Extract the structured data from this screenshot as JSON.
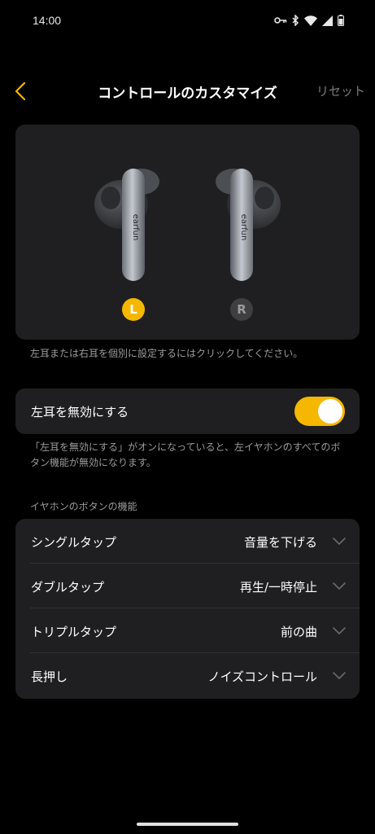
{
  "status_bar": {
    "time": "14:00",
    "icons": [
      "key-icon",
      "bluetooth-icon",
      "wifi-icon",
      "signal-icon",
      "battery-icon"
    ]
  },
  "header": {
    "title": "コントロールのカスタマイズ",
    "reset_label": "リセット",
    "back_icon": "chevron-left-icon"
  },
  "earbuds": {
    "brand": "earfun",
    "left_label": "L",
    "right_label": "R",
    "selected": "L",
    "hint": "左耳または右耳を個別に設定するにはクリックしてください。"
  },
  "disable_left": {
    "label": "左耳を無効にする",
    "enabled": true,
    "description": "「左耳を無効にする」がオンになっていると、左イヤホンのすべてのボタン機能が無効になります。"
  },
  "button_functions": {
    "section_title": "イヤホンのボタンの機能",
    "rows": [
      {
        "name": "シングルタップ",
        "value": "音量を下げる"
      },
      {
        "name": "ダブルタップ",
        "value": "再生/一時停止"
      },
      {
        "name": "トリプルタップ",
        "value": "前の曲"
      },
      {
        "name": "長押し",
        "value": "ノイズコントロール"
      }
    ]
  },
  "colors": {
    "accent": "#f5b700",
    "card_bg": "#1f1f21",
    "background": "#000000",
    "muted_text": "#9a9a9a"
  }
}
